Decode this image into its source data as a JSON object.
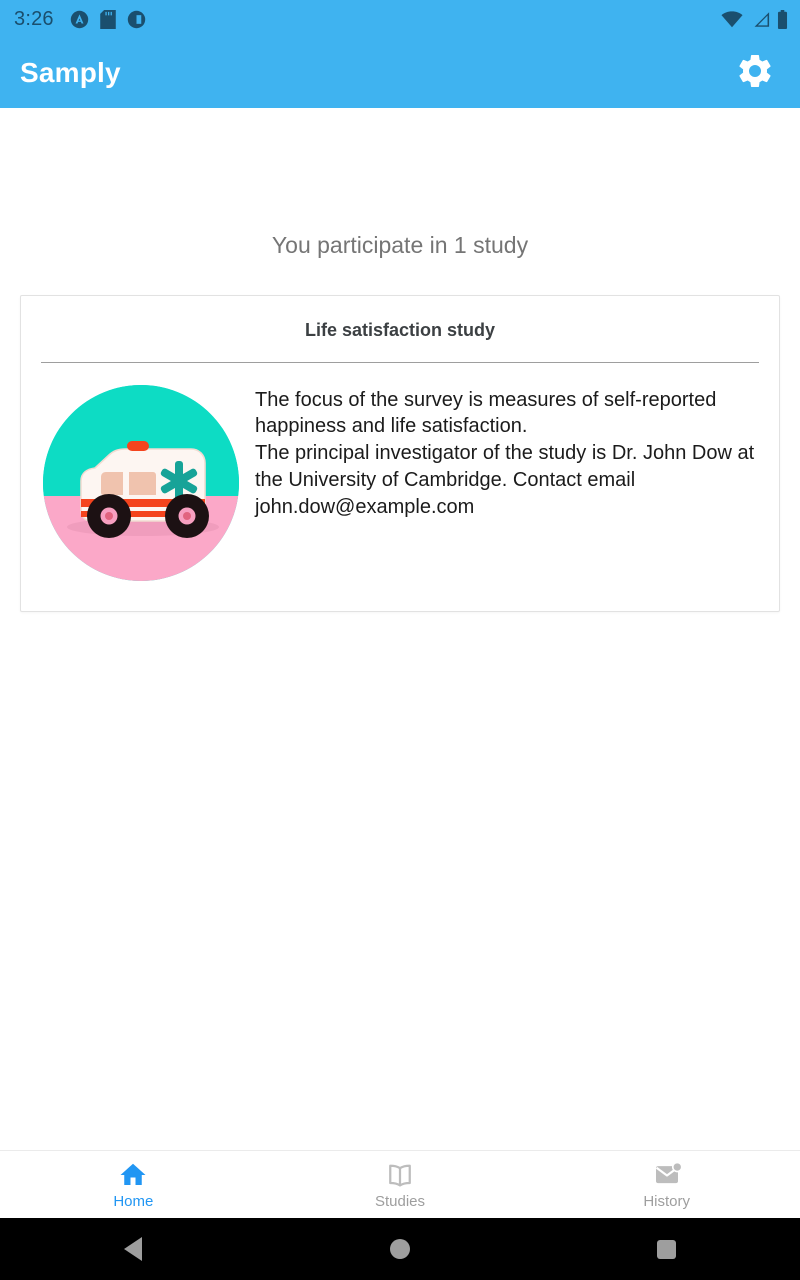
{
  "status_bar": {
    "time": "3:26",
    "left_icons": [
      "app-notification-icon",
      "sd-card-icon",
      "screenshot-icon"
    ],
    "right_icons": [
      "wifi-icon",
      "cellular-signal-icon",
      "battery-icon"
    ],
    "background_color": "#3FB3F0",
    "foreground_color": "#1A4F6E"
  },
  "app_bar": {
    "title": "Samply",
    "settings_icon": "gear-icon",
    "background_color": "#3FB3F0",
    "title_color": "#FFFFFF"
  },
  "main": {
    "participate_text": "You participate in 1 study",
    "study_card": {
      "title": "Life satisfaction study",
      "description": "The focus of the survey is measures of self-reported happiness and life satisfaction.\nThe principal investigator of the study is Dr. John Dow at the University of Cambridge. Contact email john.dow@example.com",
      "image_alt": "toy-ambulance-photo",
      "image_colors": {
        "sky": "#0DDCC4",
        "ground": "#FBA8C8",
        "vehicle_body": "#FDF6F2",
        "stripe": "#F4441E",
        "emblem": "#17A398",
        "wheel": "#1C1113",
        "hub": "#F79FC0",
        "window": "#F0C3AE"
      }
    }
  },
  "bottom_nav": {
    "active_color": "#2196F3",
    "inactive_color": "#9E9E9E",
    "items": [
      {
        "label": "Home",
        "icon": "home-icon",
        "active": true
      },
      {
        "label": "Studies",
        "icon": "book-icon",
        "active": false
      },
      {
        "label": "History",
        "icon": "mail-icon",
        "active": false
      }
    ]
  },
  "system_nav": {
    "back": "back-triangle-icon",
    "home": "home-circle-icon",
    "recents": "recents-square-icon",
    "background_color": "#000000",
    "icon_color": "#9E9E9E"
  }
}
